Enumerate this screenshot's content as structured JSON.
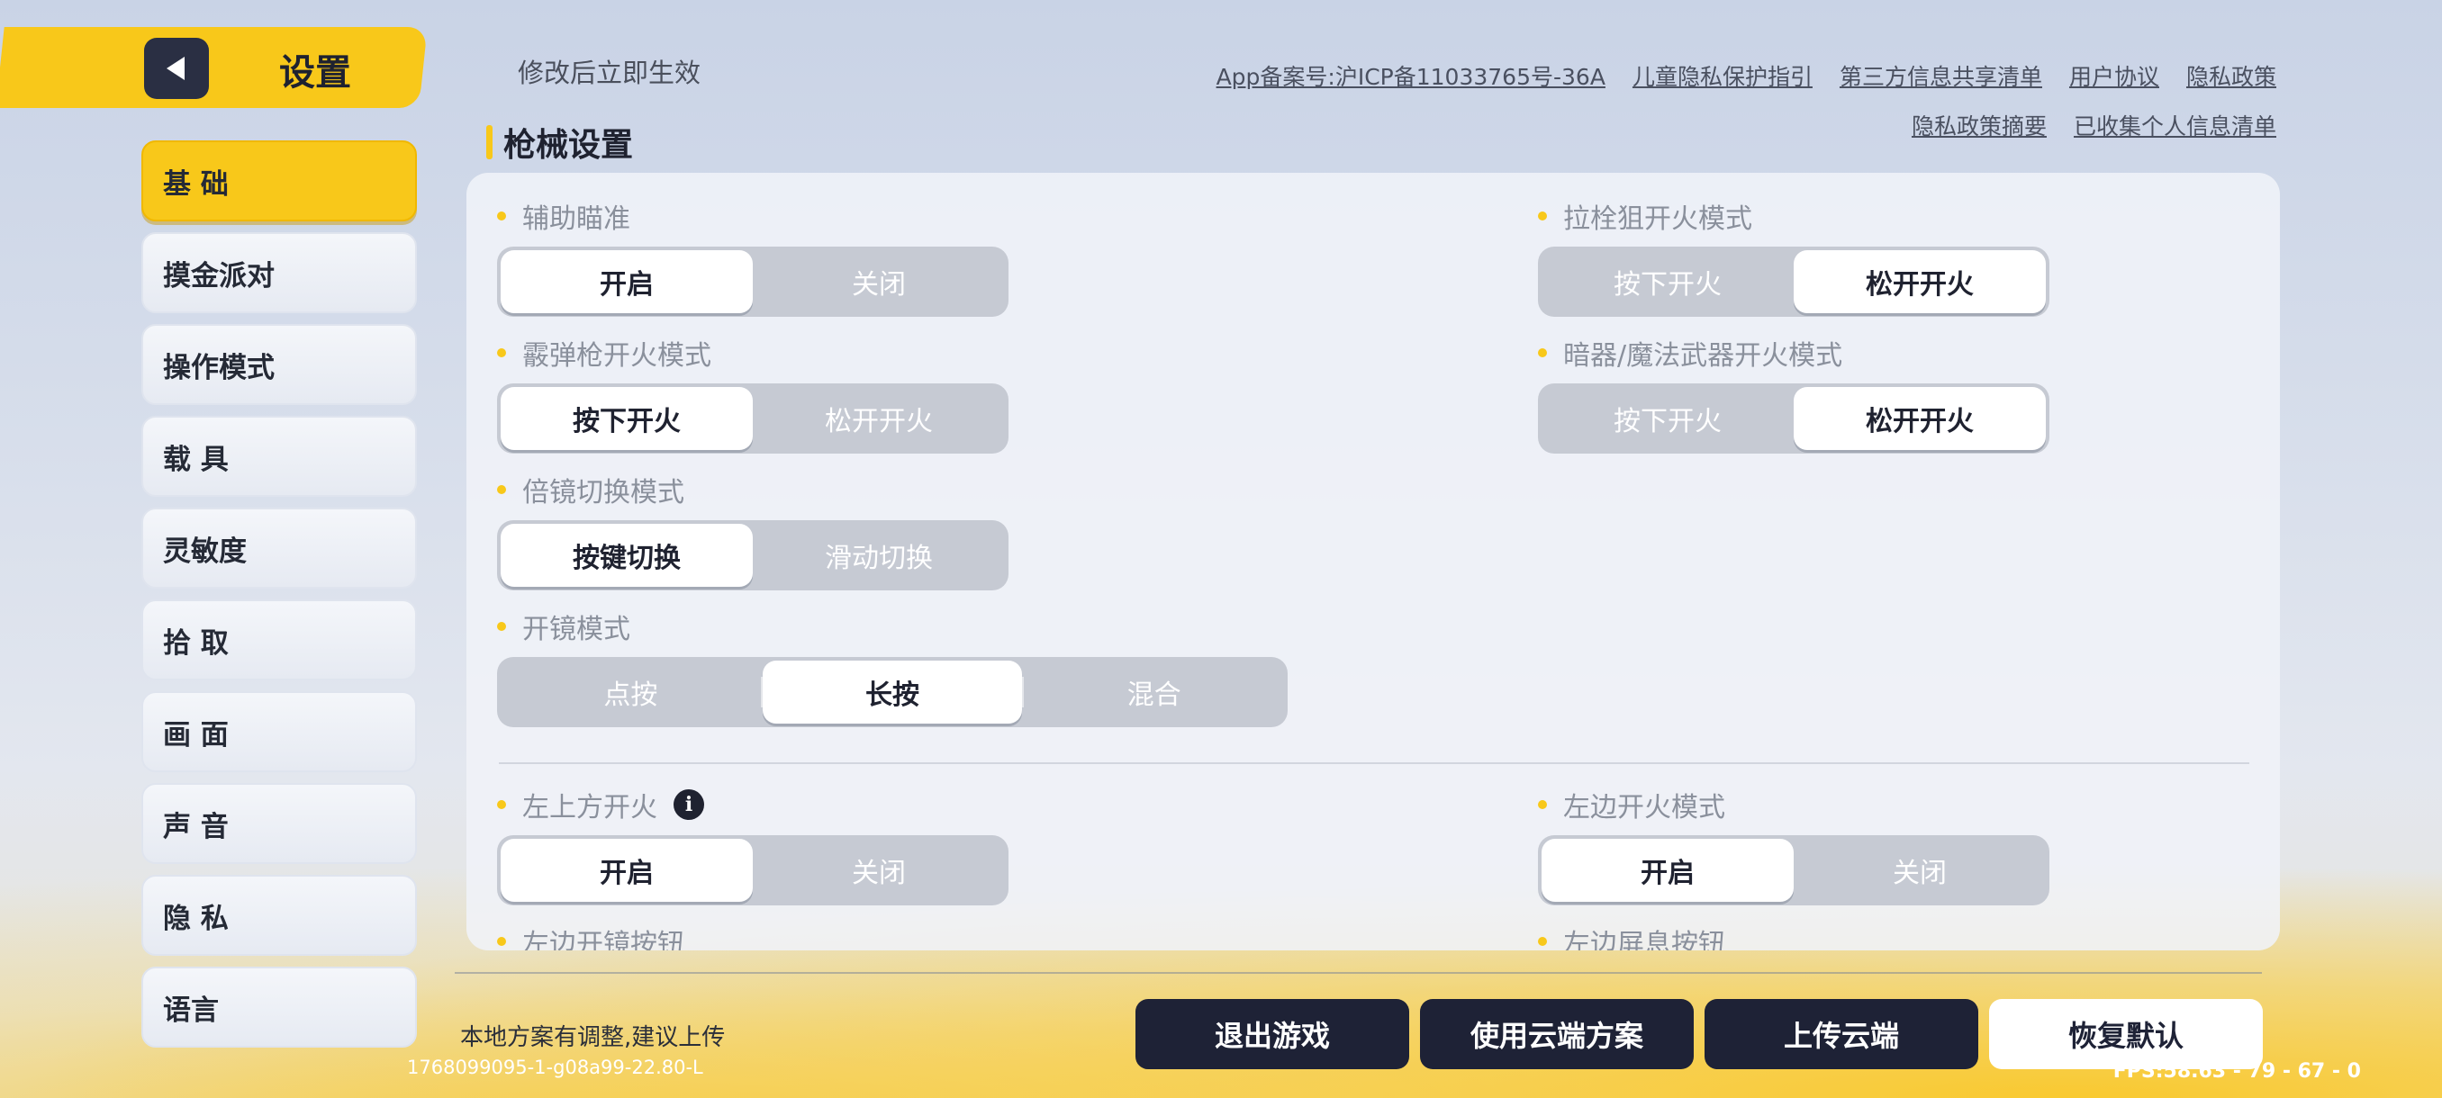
{
  "header": {
    "title": "设置",
    "hint": "修改后立即生效",
    "links_row1": [
      "App备案号:沪ICP备11033765号-36A",
      "儿童隐私保护指引",
      "第三方信息共享清单",
      "用户协议",
      "隐私政策"
    ],
    "links_row2": [
      "隐私政策摘要",
      "已收集个人信息清单"
    ]
  },
  "sidebar": {
    "items": [
      {
        "label": "基 础",
        "active": true
      },
      {
        "label": "摸金派对"
      },
      {
        "label": "操作模式"
      },
      {
        "label": "载 具"
      },
      {
        "label": "灵敏度"
      },
      {
        "label": "拾 取"
      },
      {
        "label": "画 面"
      },
      {
        "label": "声 音"
      },
      {
        "label": "隐 私"
      },
      {
        "label": "语言"
      }
    ]
  },
  "section": {
    "title": "枪械设置"
  },
  "settings": {
    "aim_assist": {
      "label": "辅助瞄准",
      "options": [
        "开启",
        "关闭"
      ],
      "selected": "开启"
    },
    "shotgun_fire": {
      "label": "霰弹枪开火模式",
      "options": [
        "按下开火",
        "松开开火"
      ],
      "selected": "按下开火"
    },
    "scope_switch": {
      "label": "倍镜切换模式",
      "options": [
        "按键切换",
        "滑动切换"
      ],
      "selected": "按键切换"
    },
    "scope_mode": {
      "label": "开镜模式",
      "options": [
        "点按",
        "长按",
        "混合"
      ],
      "selected": "长按"
    },
    "bolt_sniper_fire": {
      "label": "拉栓狙开火模式",
      "options": [
        "按下开火",
        "松开开火"
      ],
      "selected": "松开开火"
    },
    "hidden_weapon_fire": {
      "label": "暗器/魔法武器开火模式",
      "options": [
        "按下开火",
        "松开开火"
      ],
      "selected": "松开开火"
    },
    "top_left_fire": {
      "label": "左上方开火",
      "options": [
        "开启",
        "关闭"
      ],
      "selected": "开启"
    },
    "left_fire_mode": {
      "label": "左边开火模式",
      "options": [
        "开启",
        "关闭"
      ],
      "selected": "开启"
    },
    "left_scope_button": {
      "label": "左边开镜按钮"
    },
    "left_hold_breath": {
      "label": "左边屏息按钮"
    }
  },
  "footer": {
    "hint": "本地方案有调整,建议上传",
    "version": "1768099095-1-g08a99-22.80-L",
    "fps": "FPS:58.63 - 79 - 67 - 0",
    "buttons": {
      "exit": "退出游戏",
      "use_cloud": "使用云端方案",
      "upload": "上传云端",
      "reset": "恢复默认"
    }
  },
  "colors": {
    "accent": "#f8c81a",
    "dark": "#1e2236",
    "segment_bg": "#c6cad3"
  },
  "icons": {
    "back": "triangle-left-icon",
    "info": "info-icon"
  }
}
